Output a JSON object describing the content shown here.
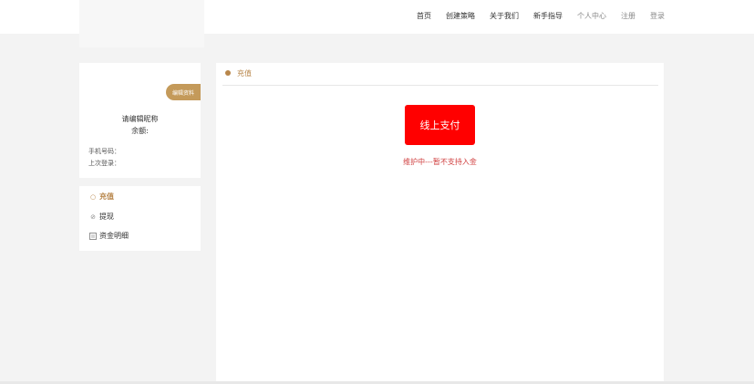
{
  "nav": {
    "items": [
      {
        "label": "首页"
      },
      {
        "label": "创建策略"
      },
      {
        "label": "关于我们"
      },
      {
        "label": "新手指导"
      },
      {
        "label": "个人中心"
      },
      {
        "label": "注册"
      },
      {
        "label": "登录"
      }
    ]
  },
  "profile": {
    "edit_badge": "编辑资料",
    "nickname": "请编辑昵称",
    "balance_label": "余额:",
    "phone_label": "手机号码：",
    "last_login_label": "上次登录："
  },
  "menu": {
    "items": [
      {
        "label": "充值",
        "icon": "circle-icon"
      },
      {
        "label": "提现",
        "icon": "withdraw-icon"
      },
      {
        "label": "资金明细",
        "icon": "document-icon"
      }
    ]
  },
  "main": {
    "header_title": "充值",
    "pay_button": "线上支付",
    "notice": "维护中---暂不支持入金"
  },
  "colors": {
    "accent": "#b8864a",
    "pay_button": "#ff0000",
    "notice": "#d04040"
  }
}
